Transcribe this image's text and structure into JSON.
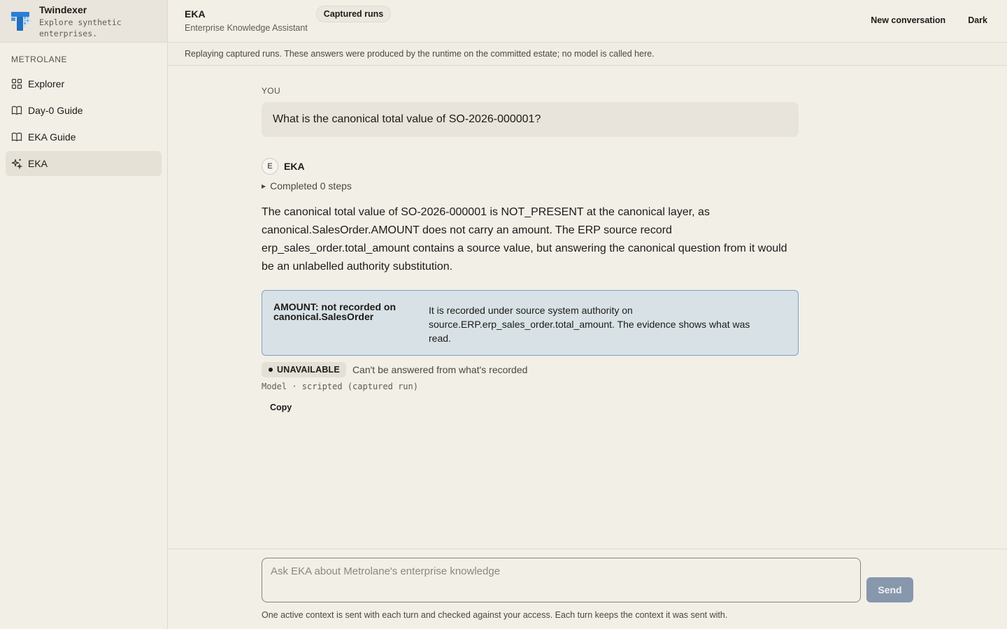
{
  "app": {
    "name": "Twindexer",
    "tagline": "Explore synthetic enterprises.",
    "accent": "#2a7fd4"
  },
  "sidebar": {
    "section_label": "METROLANE",
    "items": [
      {
        "label": "Explorer",
        "icon": "grid-icon"
      },
      {
        "label": "Day-0 Guide",
        "icon": "book-icon"
      },
      {
        "label": "EKA Guide",
        "icon": "book-icon"
      },
      {
        "label": "EKA",
        "icon": "sparkles-icon",
        "active": true
      }
    ]
  },
  "header": {
    "title": "EKA",
    "subtitle": "Enterprise Knowledge Assistant",
    "badge": "Captured runs",
    "new_conversation": "New conversation",
    "theme_toggle": "Dark"
  },
  "notice": "Replaying captured runs. These answers were produced by the runtime on the committed estate; no model is called here.",
  "conversation": {
    "you_label": "YOU",
    "question": "What is the canonical total value of SO-2026-000001?",
    "assistant_initial": "E",
    "assistant_name": "EKA",
    "steps_label": "Completed 0 steps",
    "answer": "The canonical total value of SO-2026-000001 is NOT_PRESENT at the canonical layer, as canonical.SalesOrder.AMOUNT does not carry an amount. The ERP source record erp_sales_order.total_amount contains a source value, but answering the canonical question from it would be an unlabelled authority substitution.",
    "callout": {
      "title": "AMOUNT: not recorded on canonical.SalesOrder",
      "body": "It is recorded under source system authority on source.ERP.erp_sales_order.total_amount. The evidence shows what was read."
    },
    "status": {
      "label": "UNAVAILABLE",
      "description": "Can't be answered from what's recorded"
    },
    "model_line": "Model · scripted (captured run)",
    "copy_label": "Copy"
  },
  "composer": {
    "placeholder": "Ask EKA about Metrolane's enterprise knowledge",
    "value": "",
    "send_label": "Send",
    "note": "One active context is sent with each turn and checked against your access. Each turn keeps the context it was sent with."
  }
}
